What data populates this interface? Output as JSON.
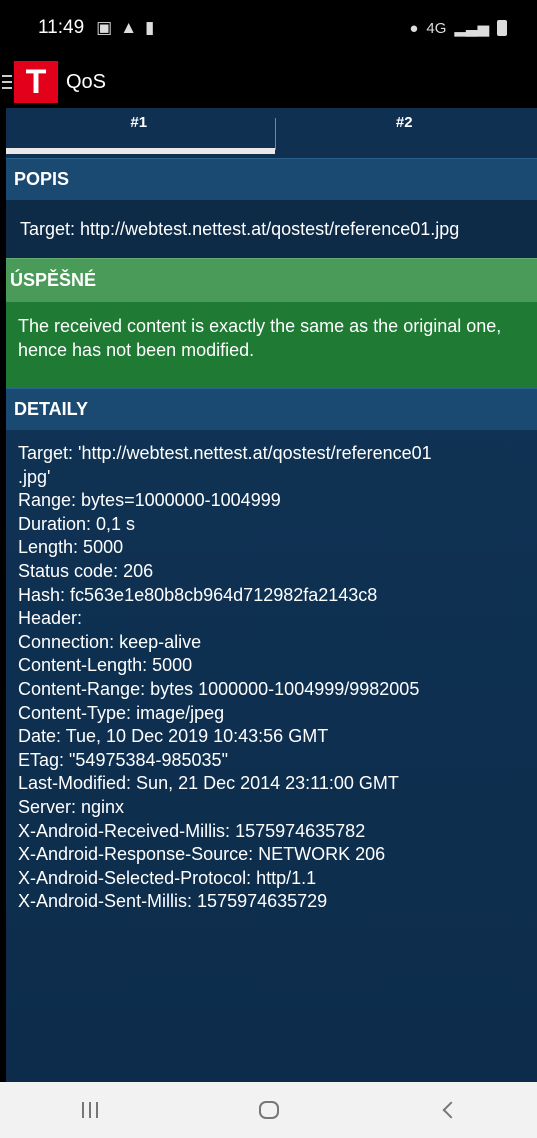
{
  "status_bar": {
    "time": "11:49",
    "network": "4G"
  },
  "app_bar": {
    "logo_letter": "T",
    "title": "QoS"
  },
  "tabs": [
    {
      "label": "#1",
      "selected": true
    },
    {
      "label": "#2",
      "selected": false
    }
  ],
  "popis": {
    "header": "POPIS",
    "text": "Target: http://webtest.nettest.at/qostest/reference01.jpg"
  },
  "result": {
    "header": "ÚSPĚŠNÉ",
    "text": "The received content is exactly the same as the original one, hence has not been modified."
  },
  "details": {
    "header": "DETAILY",
    "lines": [
      "Target: 'http://webtest.nettest.at/qostest/reference01",
      ".jpg'",
      "Range: bytes=1000000-1004999",
      "Duration: 0,1 s",
      "Length: 5000",
      "Status code: 206",
      "Hash: fc563e1e80b8cb964d712982fa2143c8",
      "Header:",
      "Connection: keep-alive",
      "Content-Length: 5000",
      "Content-Range: bytes 1000000-1004999/9982005",
      "Content-Type: image/jpeg",
      "Date: Tue, 10 Dec 2019 10:43:56 GMT",
      "ETag: \"54975384-985035\"",
      "Last-Modified: Sun, 21 Dec 2014 23:11:00 GMT",
      "Server: nginx",
      "X-Android-Received-Millis: 1575974635782",
      "X-Android-Response-Source: NETWORK 206",
      "X-Android-Selected-Protocol: http/1.1",
      "X-Android-Sent-Millis: 1575974635729"
    ]
  },
  "colors": {
    "success_header": "#4a9a5a",
    "success_body": "#1f7a34",
    "section_header": "#1a4a72",
    "logo": "#e2001a"
  }
}
